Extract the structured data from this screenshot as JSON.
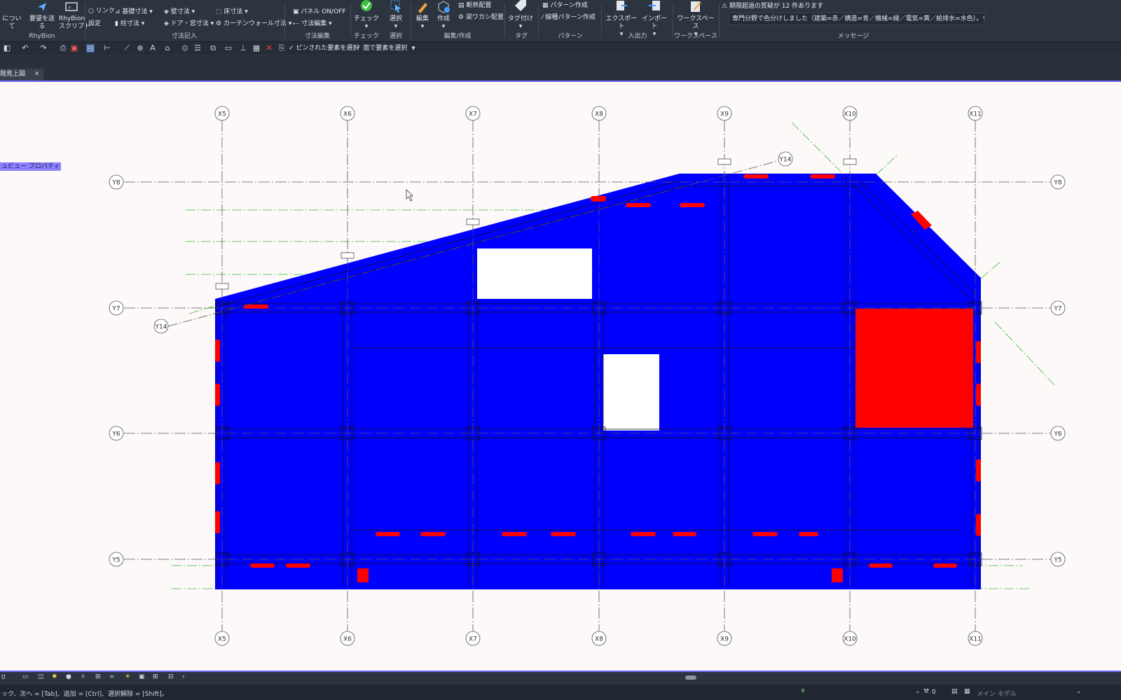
{
  "ribbon": {
    "groups": [
      {
        "label": "RhyBion",
        "buttons": [
          "について",
          "要望を送る",
          "RhyBion\nスクリプト"
        ]
      },
      {
        "label": "寸法記入",
        "small": [
          "○ リンク",
          "設定",
          "基礎寸法",
          "柱寸法",
          "壁寸法",
          "ドア・窓寸法",
          "床寸法",
          "カーテンウォール寸法"
        ]
      },
      {
        "label": "寸法編集",
        "small": [
          "パネル ON/OFF",
          "寸法編集"
        ]
      },
      {
        "label": "チェック",
        "buttons": [
          "チェック"
        ]
      },
      {
        "label": "選択",
        "buttons": [
          "選択"
        ]
      },
      {
        "label": "編集/作成",
        "buttons": [
          "編集",
          "作成"
        ],
        "small": [
          "断熱配置",
          "梁ワカシ配置"
        ]
      },
      {
        "label": "タグ",
        "buttons": [
          "タグ付け"
        ]
      },
      {
        "label": "パターン",
        "small": [
          "パターン作成",
          "線種パターン作成"
        ]
      },
      {
        "label": "入出力",
        "buttons": [
          "エクスポート",
          "インポート"
        ]
      },
      {
        "label": "ワークスペース",
        "buttons": [
          "ワークスペース"
        ]
      },
      {
        "label": "メッセージ"
      }
    ],
    "warning": "⚠ 期限超過の質疑が 12 件あります",
    "message": "専門分野で色分けしました（建築=赤／構造=青／機械=緑／電気=黄／給排水=水色）。もう一度ク"
  },
  "quick_access": {
    "check1": "✓ ピンされた要素を選択",
    "check2": "✓ 面で要素を選択"
  },
  "tab": {
    "label": "階見上図",
    "close": "✕"
  },
  "property_chip": "ュビュー プロパティ",
  "grid": {
    "x_labels": [
      "X5",
      "X6",
      "X7",
      "X8",
      "X9",
      "X10",
      "X11"
    ],
    "y_labels": [
      "Y8",
      "Y7",
      "Y6",
      "Y5"
    ],
    "diag_label": "Y14"
  },
  "colors": {
    "structure": "#0000ff",
    "architecture": "#ff0000",
    "opening": "#ffffff",
    "grid_line": "#555555",
    "green_line": "#2fbf2f"
  },
  "status": {
    "left_num": "0",
    "hint": "ック、次へ = [Tab]、追加 = [Ctrl]、選択解除 = [Shift]。",
    "count": "0",
    "model": "メイン モデル"
  }
}
